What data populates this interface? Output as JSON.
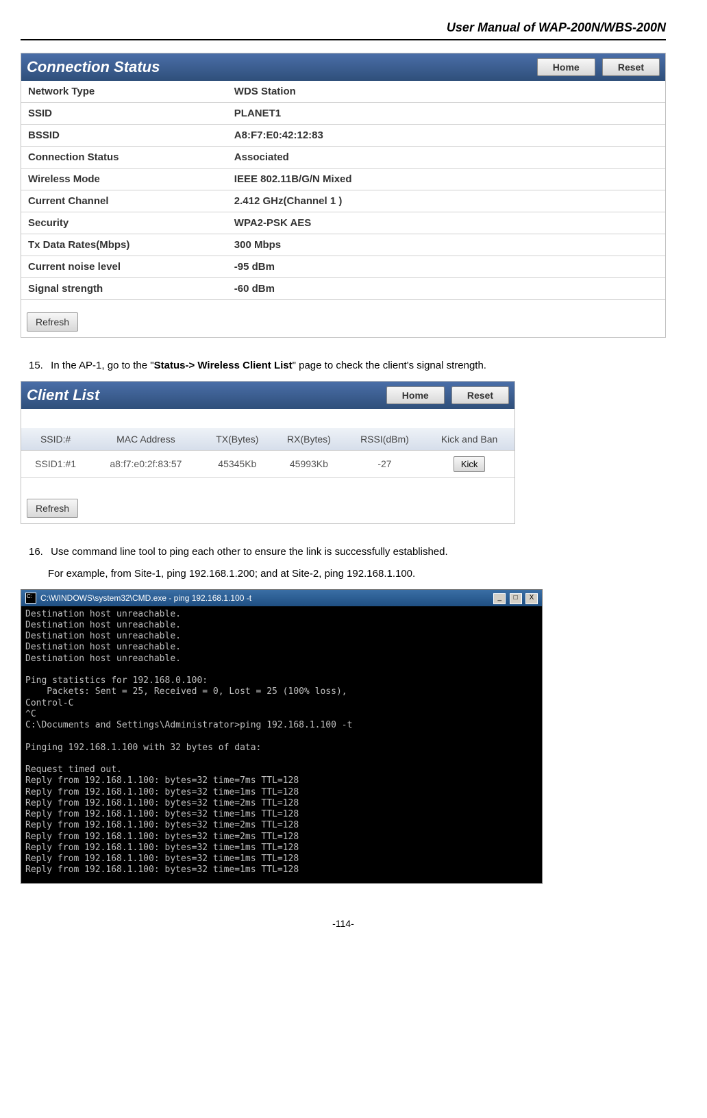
{
  "doc": {
    "header": "User Manual of WAP-200N/WBS-200N",
    "page_num": "-114-"
  },
  "panel1": {
    "title": "Connection Status",
    "home": "Home",
    "reset": "Reset",
    "refresh": "Refresh",
    "rows": [
      {
        "label": "Network Type",
        "value": "WDS Station"
      },
      {
        "label": "SSID",
        "value": "PLANET1"
      },
      {
        "label": "BSSID",
        "value": "A8:F7:E0:42:12:83"
      },
      {
        "label": "Connection Status",
        "value": "Associated"
      },
      {
        "label": "Wireless Mode",
        "value": "IEEE 802.11B/G/N Mixed"
      },
      {
        "label": "Current Channel",
        "value": "2.412 GHz(Channel 1 )"
      },
      {
        "label": "Security",
        "value": "WPA2-PSK AES"
      },
      {
        "label": "Tx Data Rates(Mbps)",
        "value": "300 Mbps"
      },
      {
        "label": "Current noise level",
        "value": "-95 dBm"
      },
      {
        "label": "Signal strength",
        "value": "-60 dBm"
      }
    ]
  },
  "step15": {
    "num": "15.",
    "text_a": "In the AP-1, go to the \"",
    "bold": "Status-> Wireless Client List",
    "text_b": "\" page to check the client's signal strength."
  },
  "panel2": {
    "title": "Client List",
    "home": "Home",
    "reset": "Reset",
    "refresh": "Refresh",
    "headers": [
      "SSID:#",
      "MAC Address",
      "TX(Bytes)",
      "RX(Bytes)",
      "RSSI(dBm)",
      "Kick and Ban"
    ],
    "row": {
      "ssid": "SSID1:#1",
      "mac": "a8:f7:e0:2f:83:57",
      "tx": "45345Kb",
      "rx": "45993Kb",
      "rssi": "-27",
      "kick": "Kick"
    }
  },
  "step16": {
    "num": "16.",
    "line1": "Use command line tool to ping each other to ensure the link is successfully established.",
    "line2": "For example, from Site-1, ping 192.168.1.200; and at Site-2, ping 192.168.1.100."
  },
  "cmd": {
    "title": "C:\\WINDOWS\\system32\\CMD.exe - ping 192.168.1.100 -t",
    "min": "_",
    "max": "□",
    "close": "X",
    "body": "Destination host unreachable.\nDestination host unreachable.\nDestination host unreachable.\nDestination host unreachable.\nDestination host unreachable.\n\nPing statistics for 192.168.0.100:\n    Packets: Sent = 25, Received = 0, Lost = 25 (100% loss),\nControl-C\n^C\nC:\\Documents and Settings\\Administrator>ping 192.168.1.100 -t\n\nPinging 192.168.1.100 with 32 bytes of data:\n\nRequest timed out.\nReply from 192.168.1.100: bytes=32 time=7ms TTL=128\nReply from 192.168.1.100: bytes=32 time=1ms TTL=128\nReply from 192.168.1.100: bytes=32 time=2ms TTL=128\nReply from 192.168.1.100: bytes=32 time=1ms TTL=128\nReply from 192.168.1.100: bytes=32 time=2ms TTL=128\nReply from 192.168.1.100: bytes=32 time=2ms TTL=128\nReply from 192.168.1.100: bytes=32 time=1ms TTL=128\nReply from 192.168.1.100: bytes=32 time=1ms TTL=128\nReply from 192.168.1.100: bytes=32 time=1ms TTL=128"
  }
}
